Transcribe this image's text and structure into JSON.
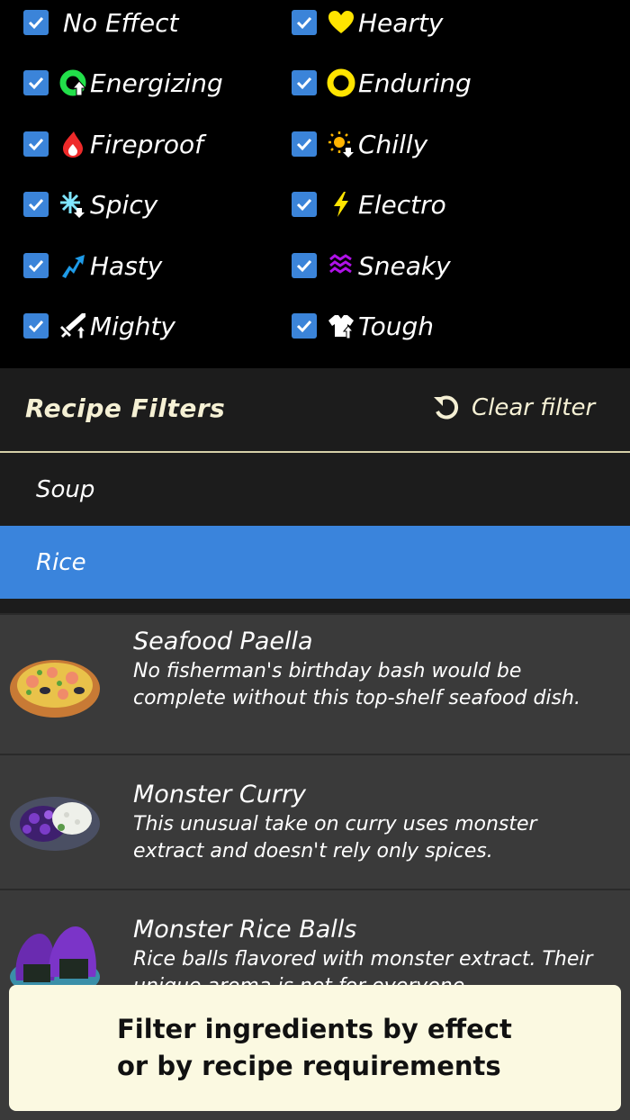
{
  "effects": [
    {
      "label": "No Effect",
      "checked": true,
      "icon": "none"
    },
    {
      "label": "Hearty",
      "checked": true,
      "icon": "heart-icon"
    },
    {
      "label": "Energizing",
      "checked": true,
      "icon": "stamina-wheel-icon"
    },
    {
      "label": "Enduring",
      "checked": true,
      "icon": "stamina-ring-icon"
    },
    {
      "label": "Fireproof",
      "checked": true,
      "icon": "flame-icon"
    },
    {
      "label": "Chilly",
      "checked": true,
      "icon": "sun-down-icon"
    },
    {
      "label": "Spicy",
      "checked": true,
      "icon": "snowflake-down-icon"
    },
    {
      "label": "Electro",
      "checked": true,
      "icon": "lightning-icon"
    },
    {
      "label": "Hasty",
      "checked": true,
      "icon": "speed-arrow-icon"
    },
    {
      "label": "Sneaky",
      "checked": true,
      "icon": "stealth-waves-icon"
    },
    {
      "label": "Mighty",
      "checked": true,
      "icon": "sword-up-icon"
    },
    {
      "label": "Tough",
      "checked": true,
      "icon": "armor-up-icon"
    }
  ],
  "recipe_filters": {
    "title": "Recipe Filters",
    "clear_label": "Clear filter",
    "categories": [
      {
        "label": "Soup",
        "selected": false
      },
      {
        "label": "Rice",
        "selected": true
      }
    ]
  },
  "recipes": [
    {
      "name": "Seafood Paella",
      "description": "No fisherman's birthday bash would be complete without this top-shelf seafood dish.",
      "image": "seafood-paella-image"
    },
    {
      "name": "Monster Curry",
      "description": "This unusual take on curry uses monster extract and doesn't rely only spices.",
      "image": "monster-curry-image"
    },
    {
      "name": "Monster Rice Balls",
      "description": "Rice balls flavored with monster extract. Their unique aroma is not for everyone.",
      "image": "monster-rice-balls-image"
    }
  ],
  "banner": {
    "line1": "Filter ingredients by effect",
    "line2": "or by recipe requirements"
  },
  "colors": {
    "checkbox": "#3b84d9",
    "selected_category": "#3a84dc",
    "header_text": "#f5f0d4",
    "banner_bg": "#fbf9e1"
  }
}
